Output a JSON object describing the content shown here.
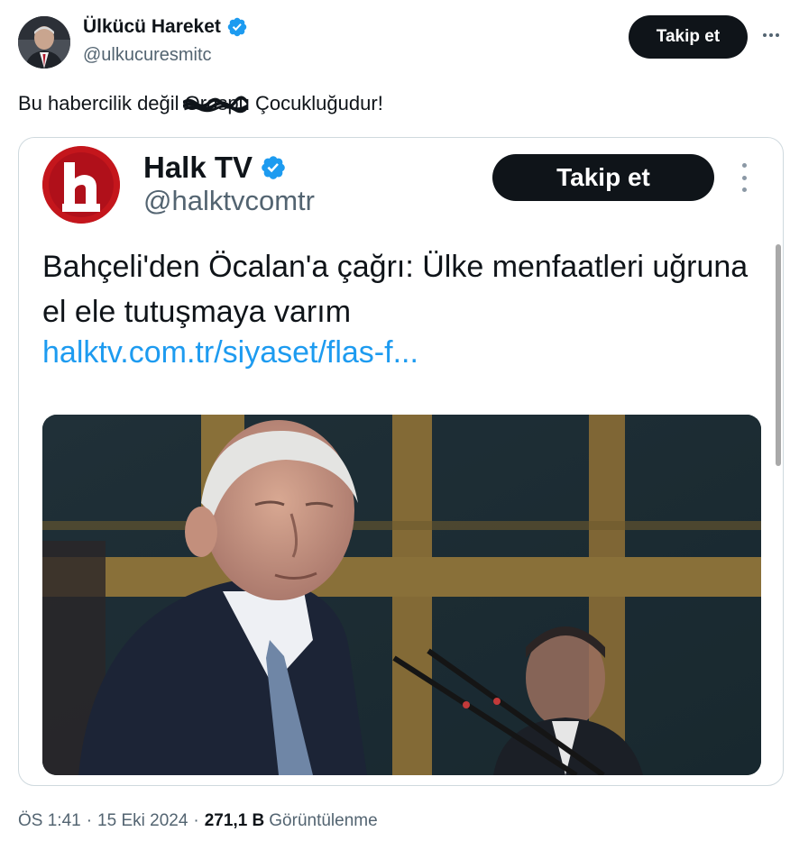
{
  "author": {
    "display_name": "Ülkücü Hareket",
    "handle": "@ulkucuresmitc",
    "verified": true,
    "follow_label": "Takip et",
    "more_icon": "more-horizontal-icon"
  },
  "tweet": {
    "text_before": "Bu habercilik değil ",
    "scribbled_word": "Orospu",
    "text_after": " Çocukluğudur!"
  },
  "embedded": {
    "display_name": "Halk TV",
    "handle": "@halktvcomtr",
    "verified": true,
    "follow_label": "Takip et",
    "logo_text": "halk",
    "headline": "Bahçeli'den Öcalan'a çağrı: Ülke menfaatleri uğruna el ele tutuşmaya varım",
    "link": "halktv.com.tr/siyaset/flas-f..."
  },
  "footer": {
    "time": "ÖS 1:41",
    "date": "15 Eki 2024",
    "views_count": "271,1 B",
    "views_label": "Görüntülenme"
  },
  "colors": {
    "accent": "#1d9bf0",
    "text": "#0f1419",
    "muted": "#536471",
    "border": "#cfd9de",
    "halk_red": "#c4161c"
  }
}
